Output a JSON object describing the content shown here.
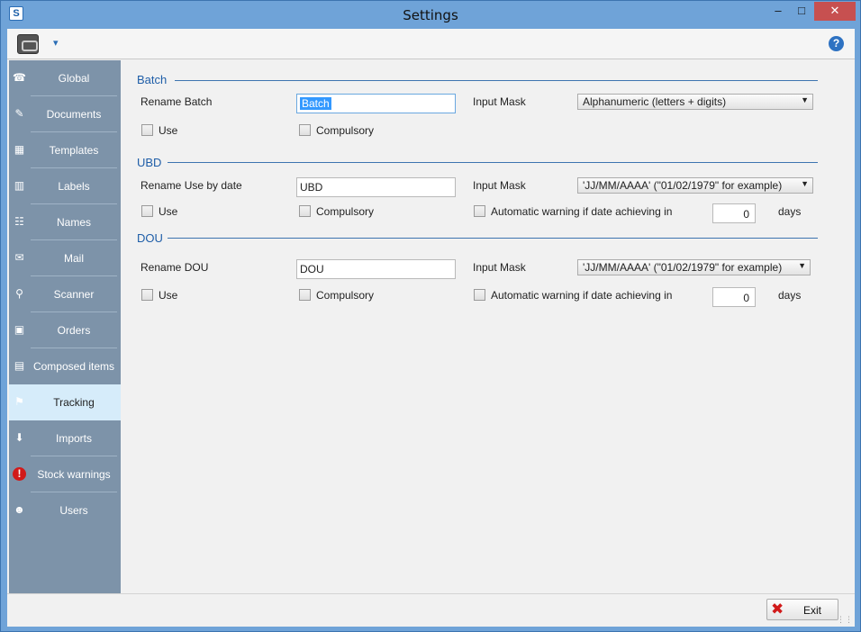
{
  "window": {
    "title": "Settings",
    "app_icon": "S"
  },
  "toolbar": {
    "dropdown_glyph": "▾",
    "help_glyph": "?"
  },
  "sidebar": {
    "items": [
      {
        "label": "Global",
        "icon": "global-icon",
        "glyph": "☎"
      },
      {
        "label": "Documents",
        "icon": "documents-icon",
        "glyph": "✎"
      },
      {
        "label": "Templates",
        "icon": "templates-icon",
        "glyph": "▦"
      },
      {
        "label": "Labels",
        "icon": "barcode-icon",
        "glyph": "▥"
      },
      {
        "label": "Names",
        "icon": "names-icon",
        "glyph": "☷"
      },
      {
        "label": "Mail",
        "icon": "mail-icon",
        "glyph": "✉"
      },
      {
        "label": "Scanner",
        "icon": "scanner-icon",
        "glyph": "⚲"
      },
      {
        "label": "Orders",
        "icon": "orders-icon",
        "glyph": "▣"
      },
      {
        "label": "Composed items",
        "icon": "composed-items-icon",
        "glyph": "▤"
      },
      {
        "label": "Tracking",
        "icon": "tracking-icon",
        "glyph": "⚑",
        "active": true
      },
      {
        "label": "Imports",
        "icon": "imports-icon",
        "glyph": "⬇"
      },
      {
        "label": "Stock warnings",
        "icon": "warning-icon",
        "glyph": "!"
      },
      {
        "label": "Users",
        "icon": "users-icon",
        "glyph": "☻"
      }
    ]
  },
  "batch": {
    "title": "Batch",
    "rename_label": "Rename Batch",
    "rename_value": "Batch",
    "mask_label": "Input Mask",
    "mask_value": "Alphanumeric (letters + digits)",
    "use_label": "Use",
    "compulsory_label": "Compulsory"
  },
  "ubd": {
    "title": "UBD",
    "rename_label": "Rename Use by date",
    "rename_value": "UBD",
    "mask_label": "Input Mask",
    "mask_value": "'JJ/MM/AAAA' (\"01/02/1979\" for example)",
    "use_label": "Use",
    "compulsory_label": "Compulsory",
    "warning_label": "Automatic warning if date achieving in",
    "days_value": "0",
    "days_label": "days"
  },
  "dou": {
    "title": "DOU",
    "rename_label": "Rename DOU",
    "rename_value": "DOU",
    "mask_label": "Input Mask",
    "mask_value": "'JJ/MM/AAAA' (\"01/02/1979\" for example)",
    "use_label": "Use",
    "compulsory_label": "Compulsory",
    "warning_label": "Automatic warning if date achieving in",
    "days_value": "0",
    "days_label": "days"
  },
  "footer": {
    "exit_label": "Exit"
  },
  "colors": {
    "accent": "#1f5ea8",
    "sidebar": "#7d93a9",
    "active_item": "#d6ecfa",
    "close": "#c75050"
  }
}
